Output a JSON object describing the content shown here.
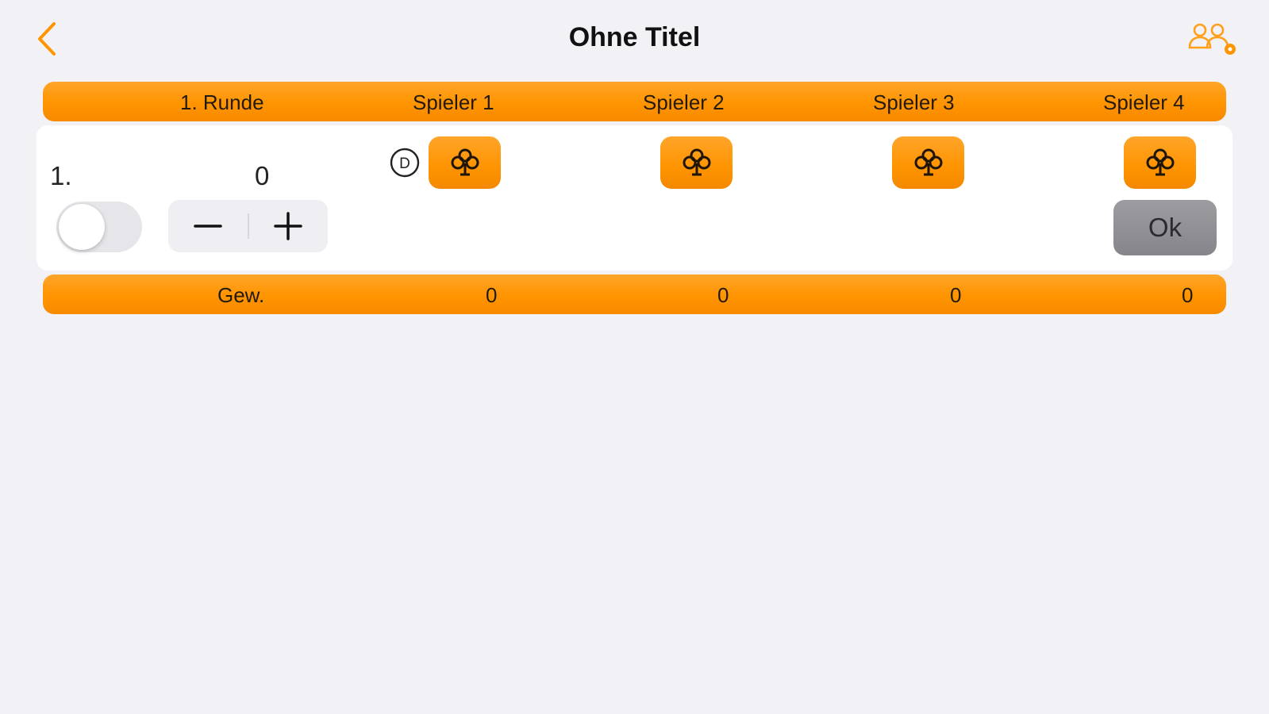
{
  "nav": {
    "title": "Ohne Titel"
  },
  "header": {
    "round_label": "1. Runde",
    "players": [
      "Spieler 1",
      "Spieler 2",
      "Spieler 3",
      "Spieler 4"
    ]
  },
  "round": {
    "number": "1.",
    "value": "0",
    "dealer_marker": "D",
    "suit_icon": "club-icon",
    "ok_label": "Ok",
    "toggle_on": false
  },
  "footer": {
    "label": "Gew.",
    "totals": [
      "0",
      "0",
      "0",
      "0"
    ]
  },
  "colors": {
    "accent": "#ff9500",
    "background": "#f1f1f6",
    "card": "#ffffff",
    "ok_button": "#8e8e93"
  }
}
